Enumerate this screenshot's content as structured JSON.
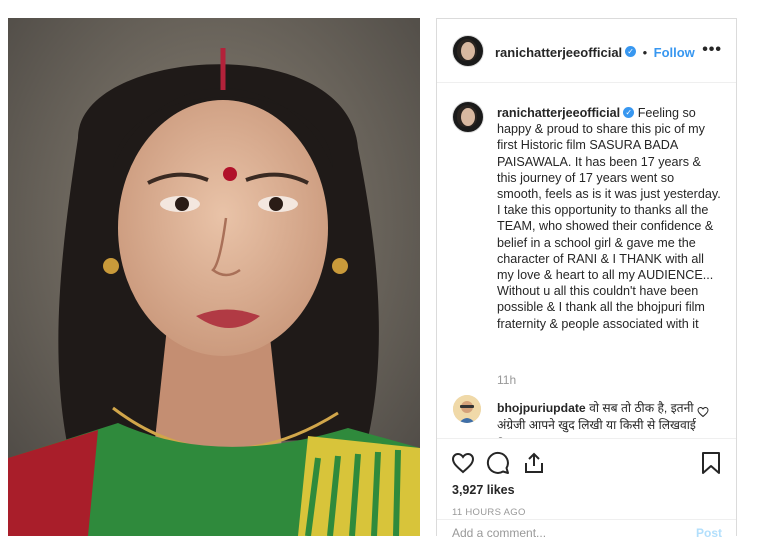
{
  "post": {
    "username": "ranichatterjeeofficial",
    "follow_label": "Follow",
    "more_icon": "more-horizontal-icon",
    "caption": "Feeling so happy & proud to share this pic of my first Historic film SASURA BADA PAISAWALA. It has been 17 years & this journey of 17 years went so smooth, feels as is it was just yesterday. I take this opportunity to thanks all the TEAM, who showed their confidence & belief in a school girl & gave me the character of RANI & I THANK with all my love & heart to all my AUDIENCE... Without u all this couldn't have been possible & I thank all the bhojpuri film fraternity & people associated with it",
    "caption_time": "11h",
    "comment": {
      "username": "bhojpuriupdate",
      "text": "वो सब तो ठीक है, इतनी अंग्रेजी आपने खुद लिखी या किसी से लिखवाई ?"
    },
    "likes": "3,927 likes",
    "time_ago": "11 HOURS AGO",
    "add_comment_placeholder": "Add a comment...",
    "post_label": "Post",
    "colors": {
      "accent": "#3897f0",
      "border": "#dbdbdb",
      "muted": "#999999",
      "post_disabled": "#b2dffc"
    }
  }
}
